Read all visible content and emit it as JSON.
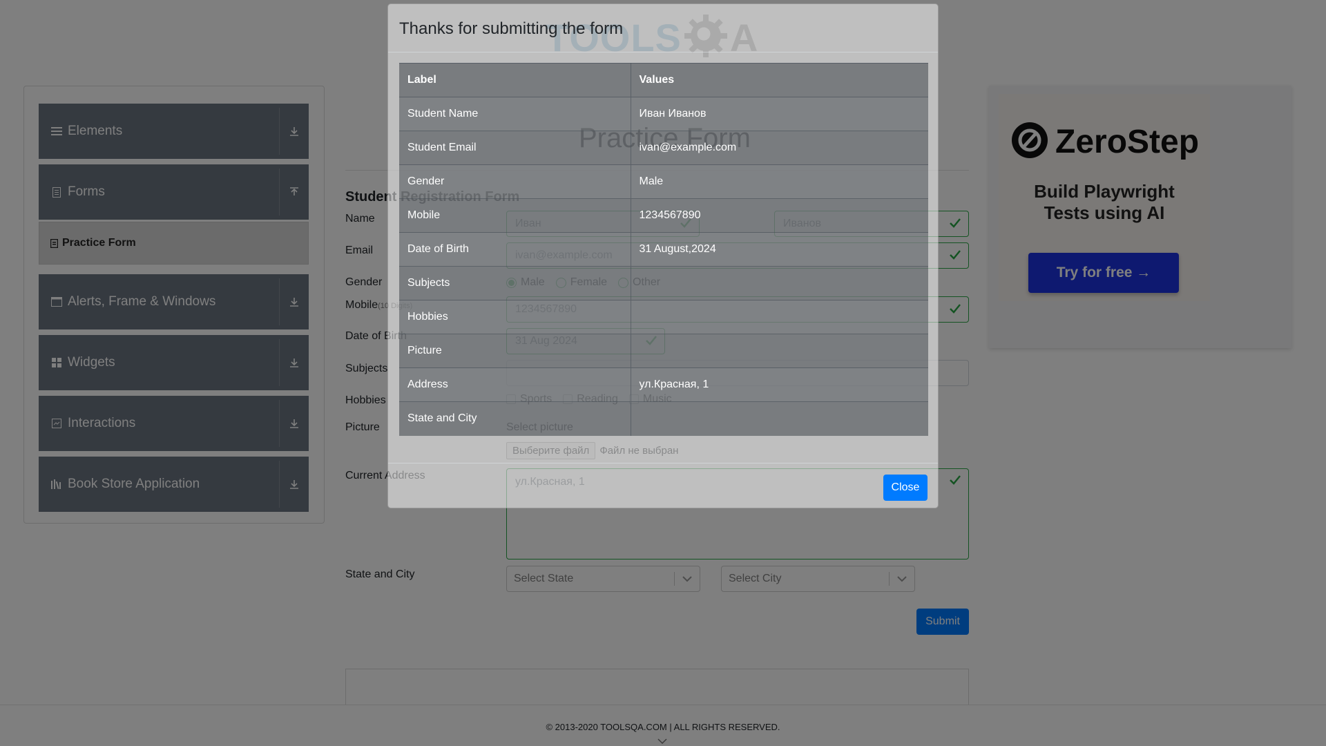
{
  "colors": {
    "sidebar_group": "#6b7480",
    "accent": "#007bff",
    "valid": "#28a745",
    "ad_cta": "#1d33e0",
    "modal_table": "#343a40"
  },
  "logo": {
    "text": "TOOLS",
    "suffix": "A"
  },
  "sidebar": {
    "groups": [
      {
        "label": "Elements",
        "icon": "menu-icon",
        "arrow": "download-icon"
      },
      {
        "label": "Forms",
        "icon": "document-icon",
        "arrow": "upload-icon"
      },
      {
        "label": "Alerts, Frame & Windows",
        "icon": "window-icon",
        "arrow": "download-icon"
      },
      {
        "label": "Widgets",
        "icon": "grid-icon",
        "arrow": "download-icon"
      },
      {
        "label": "Interactions",
        "icon": "interaction-icon",
        "arrow": "download-icon"
      },
      {
        "label": "Book Store Application",
        "icon": "books-icon",
        "arrow": "download-icon"
      }
    ],
    "active_item": "Practice Form"
  },
  "main": {
    "title": "Practice Form",
    "form_heading": "Student Registration Form",
    "labels": {
      "name": "Name",
      "email": "Email",
      "gender": "Gender",
      "mobile": "Mobile",
      "mobile_hint": "(10 Digits)",
      "dob": "Date of Birth",
      "subjects": "Subjects",
      "hobbies": "Hobbies",
      "picture": "Picture",
      "address": "Current Address",
      "state_city": "State and City"
    },
    "values": {
      "first_name": "Иван",
      "last_name": "Иванов",
      "email": "ivan@example.com",
      "mobile": "1234567890",
      "dob": "31 Aug 2024",
      "address": "ул.Красная, 1"
    },
    "gender_options": [
      "Male",
      "Female",
      "Other"
    ],
    "hobby_options": [
      "Sports",
      "Reading",
      "Music"
    ],
    "picture_prompt": "Select picture",
    "file_button": "Выберите файл",
    "file_status": "Файл не выбран",
    "state_placeholder": "Select State",
    "city_placeholder": "Select City",
    "submit_label": "Submit"
  },
  "footer": {
    "text": "© 2013-2020 TOOLSQA.COM | ALL RIGHTS RESERVED."
  },
  "ad": {
    "brand": "ZeroStep",
    "tagline_line1": "Build Playwright",
    "tagline_line2": "Tests using AI",
    "cta": "Try for free →"
  },
  "modal": {
    "title": "Thanks for submitting the form",
    "headers": [
      "Label",
      "Values"
    ],
    "rows": [
      {
        "label": "Student Name",
        "value": "Иван Иванов"
      },
      {
        "label": "Student Email",
        "value": "ivan@example.com"
      },
      {
        "label": "Gender",
        "value": "Male"
      },
      {
        "label": "Mobile",
        "value": "1234567890"
      },
      {
        "label": "Date of Birth",
        "value": "31 August,2024"
      },
      {
        "label": "Subjects",
        "value": ""
      },
      {
        "label": "Hobbies",
        "value": ""
      },
      {
        "label": "Picture",
        "value": ""
      },
      {
        "label": "Address",
        "value": "ул.Красная, 1"
      },
      {
        "label": "State and City",
        "value": ""
      }
    ],
    "close_label": "Close"
  }
}
